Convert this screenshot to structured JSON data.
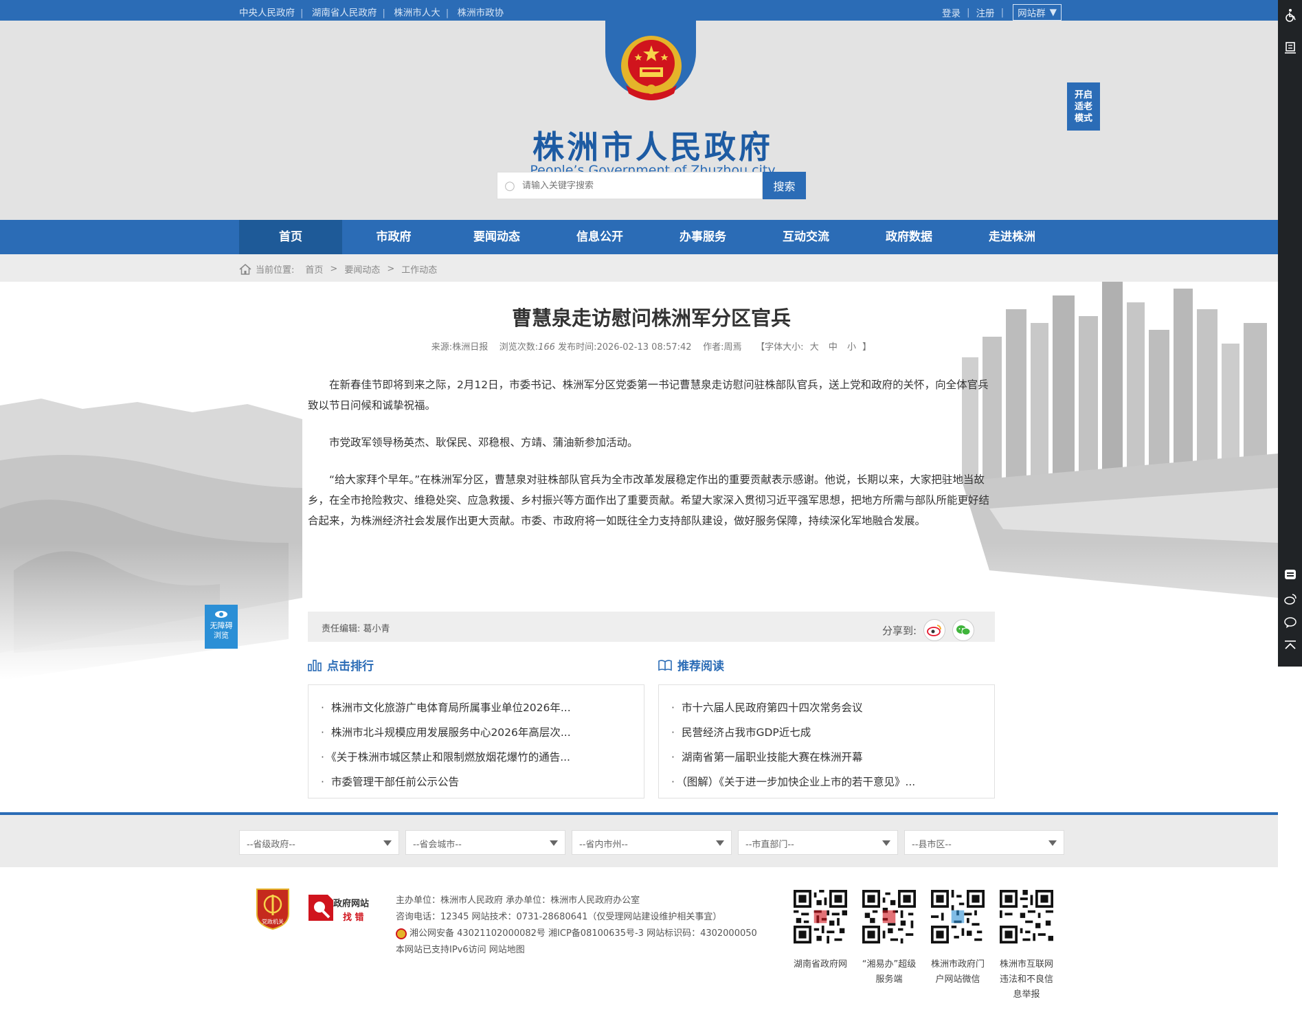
{
  "topbar": {
    "links": [
      "中央人民政府",
      "湖南省人民政府",
      "株洲市人大",
      "株洲市政协"
    ],
    "login": "登录",
    "register": "注册",
    "site_group": "网站群"
  },
  "header": {
    "title": "株洲市人民政府",
    "subtitle": "People’s Government of Zhuzhou city",
    "search_placeholder": "请输入关键字搜索",
    "search_button": "搜索",
    "elder_mode": "开启适老模式"
  },
  "nav": {
    "items": [
      "首页",
      "市政府",
      "要闻动态",
      "信息公开",
      "办事服务",
      "互动交流",
      "政府数据",
      "走进株洲"
    ]
  },
  "breadcrumb": {
    "label": "当前位置:",
    "items": [
      "首页",
      "要闻动态",
      "工作动态"
    ]
  },
  "article": {
    "title": "曹慧泉走访慰问株洲军分区官兵",
    "source_label": "来源:",
    "source": "株洲日报",
    "views_label": "浏览次数:",
    "views": "166",
    "time_label": "发布时间:",
    "time": "2026-02-13 08:57:42",
    "author_label": "作者:",
    "author": "周焉",
    "font_size_label": "【字体大小:",
    "font_sizes": [
      "大",
      "中",
      "小"
    ],
    "font_size_close": "】",
    "paragraphs": [
      "在新春佳节即将到来之际，2月12日，市委书记、株洲军分区党委第一书记曹慧泉走访慰问驻株部队官兵，送上党和政府的关怀，向全体官兵致以节日问候和诚挚祝福。",
      "市党政军领导杨英杰、耿保民、邓稳根、方靖、蒲油新参加活动。",
      "“给大家拜个早年。”在株洲军分区，曹慧泉对驻株部队官兵为全市改革发展稳定作出的重要贡献表示感谢。他说，长期以来，大家把驻地当故乡，在全市抢险救灾、维稳处突、应急救援、乡村振兴等方面作出了重要贡献。希望大家深入贯彻习近平强军思想，把地方所需与部队所能更好结合起来，为株洲经济社会发展作出更大贡献。市委、市政府将一如既往全力支持部队建设，做好服务保障，持续深化军地融合发展。"
    ],
    "editor_label": "责任编辑:",
    "editor": "葛小青",
    "share_label": "分享到:"
  },
  "hot_ranking": {
    "title": "点击排行",
    "items": [
      "株洲市文化旅游广电体育局所属事业单位2026年...",
      "株洲市北斗规模应用发展服务中心2026年高层次...",
      "《关于株洲市城区禁止和限制燃放烟花爆竹的通告...",
      "市委管理干部任前公示公告"
    ]
  },
  "recommended": {
    "title": "推荐阅读",
    "items": [
      "市十六届人民政府第四十四次常务会议",
      "民营经济占我市GDP近七成",
      "湖南省第一届职业技能大赛在株洲开幕",
      "（图解）《关于进一步加快企业上市的若干意见》..."
    ]
  },
  "link_selects": [
    "--省级政府--",
    "--省会城市--",
    "--省内市州--",
    "--市直部门--",
    "--县市区--"
  ],
  "footer": {
    "badge_text": "党政机关",
    "find_error_title": "政府网站",
    "find_error_sub": "找 错",
    "lines": [
      "主办单位：株洲市人民政府  承办单位：株洲市人民政府办公室",
      "咨询电话：12345  网站技术：0731-28680641（仅受理网站建设维护相关事宜）",
      "湘公网安备 43021102000082号   湘ICP备08100635号-3   网站标识码：4302000050",
      "本网站已支持IPv6访问   网站地图"
    ],
    "qr_codes": [
      "湖南省政府网",
      "“湘易办”超级服务端",
      "株洲市政府门户网站微信",
      "株洲市互联网违法和不良信息举报"
    ]
  },
  "accessibility": {
    "label": "无障碍浏览"
  },
  "colors": {
    "primary": "#2b6cb6",
    "nav_active": "#1e5a98",
    "header_bg": "#e3e3e3"
  }
}
